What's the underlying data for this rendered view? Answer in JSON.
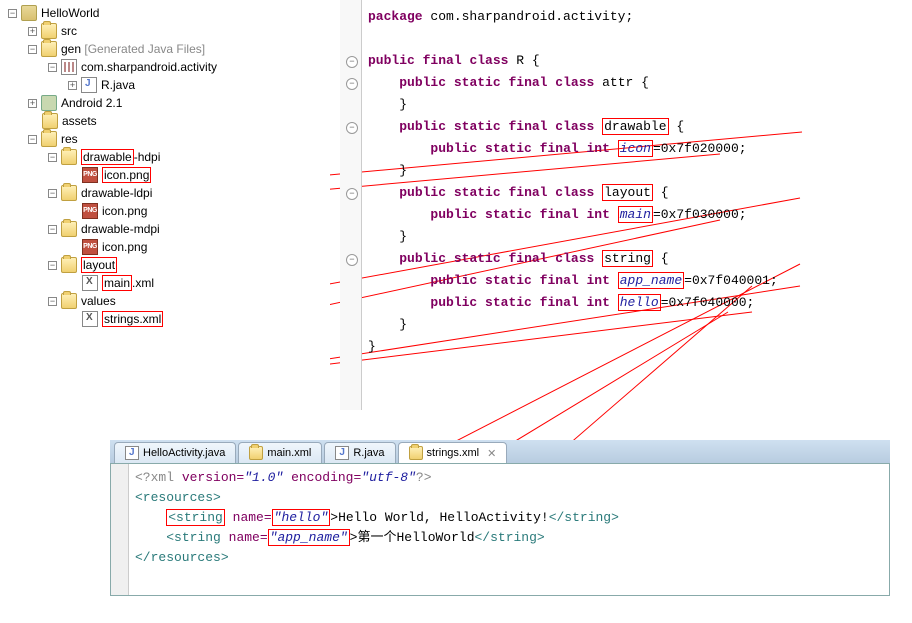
{
  "tree": {
    "project": "HelloWorld",
    "src": "src",
    "gen": "gen",
    "gen_suffix": "[Generated Java Files]",
    "pkg": "com.sharpandroid.activity",
    "rjava": "R.java",
    "android": "Android 2.1",
    "assets": "assets",
    "res": "res",
    "draw_hdpi_pre": "drawable",
    "draw_hdpi_suf": "-hdpi",
    "icon_png": "icon.png",
    "draw_ldpi": "drawable-ldpi",
    "draw_mdpi": "drawable-mdpi",
    "layout": "layout",
    "main_xml_pre": "main",
    "main_xml_suf": ".xml",
    "values": "values",
    "strings_xml_pre": "strings",
    "strings_xml_suf": ".xml"
  },
  "code": {
    "pkg_kw": "package",
    "pkg_name": "com.sharpandroid.activity;",
    "public": "public",
    "static": "static",
    "final": "final",
    "class": "class",
    "int": "int",
    "R": "R",
    "attr": "attr",
    "drawable": "drawable",
    "icon": "icon",
    "icon_val": "=0x7f020000;",
    "layout": "layout",
    "main": "main",
    "main_val": "=0x7f030000;",
    "string": "string",
    "app_name": "app_name",
    "app_name_val": "=0x7f040001;",
    "hello": "hello",
    "hello_val": "=0x7f040000;"
  },
  "tabs": {
    "t1": "HelloActivity.java",
    "t2": "main.xml",
    "t3": "R.java",
    "t4": "strings.xml"
  },
  "xml": {
    "pi_open": "<?xml",
    "ver_a": "version=",
    "ver_v": "\"1.0\"",
    "enc_a": "encoding=",
    "enc_v": "\"utf-8\"",
    "pi_close": "?>",
    "res_open": "<resources>",
    "res_close": "</resources>",
    "str_open": "<string",
    "name_a": "name=",
    "hello_v": "\"hello\"",
    "hello_txt": ">Hello World, HelloActivity!",
    "appn_v": "\"app_name\"",
    "appn_txt": "第一个HelloWorld",
    "str_close": "</string>"
  }
}
